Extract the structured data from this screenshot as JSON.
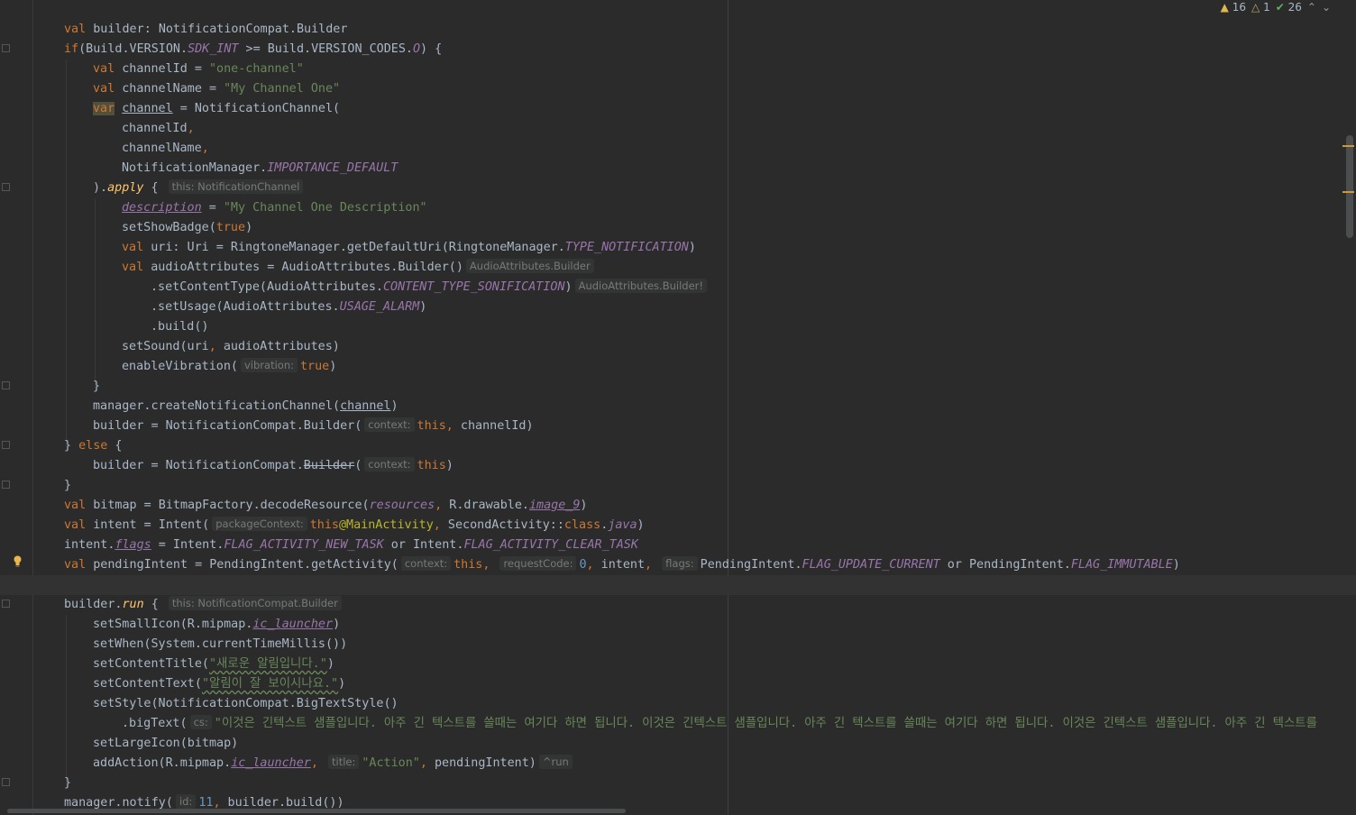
{
  "status": {
    "warnings": "16",
    "weak_warnings": "1",
    "typos": "26",
    "warning_icon": "warning-triangle-icon",
    "weak_warning_icon": "weak-warning-triangle-icon",
    "typo_icon": "typo-check-icon",
    "nav_up_icon": "chevron-up-icon",
    "nav_down_icon": "chevron-down-icon"
  },
  "hints": {
    "this_channel": "this: NotificationChannel",
    "audio_builder": "AudioAttributes.Builder",
    "audio_builder_bang": "AudioAttributes.Builder!",
    "vibration": "vibration:",
    "context": "context:",
    "package_context": "packageContext:",
    "request_code": "requestCode:",
    "flags": "flags:",
    "this_builder": "this: NotificationCompat.Builder",
    "cs": "cs:",
    "title": "title:",
    "run": "^run",
    "id": "id:"
  },
  "code": {
    "builder_decl_name": "builder",
    "builder_decl_type": "NotificationCompat.Builder",
    "sdk_int": "SDK_INT",
    "version_code": "O",
    "channel_id_value": "\"one-channel\"",
    "channel_name_value": "\"My Channel One\"",
    "importance": "IMPORTANCE_DEFAULT",
    "description_value": "\"My Channel One Description\"",
    "type_notification": "TYPE_NOTIFICATION",
    "content_type": "CONTENT_TYPE_SONIFICATION",
    "usage_alarm": "USAGE_ALARM",
    "image_res": "image_9",
    "main_activity": "@MainActivity",
    "flag_new_task": "FLAG_ACTIVITY_NEW_TASK",
    "flag_clear_task": "FLAG_ACTIVITY_CLEAR_TASK",
    "request_code_value": "0",
    "flag_update_current": "FLAG_UPDATE_CURRENT",
    "flag_immutable": "FLAG_IMMUTABLE",
    "ic_launcher": "ic_launcher",
    "content_title": "\"새로운 알림입니다.\"",
    "content_text": "\"알림이 잘 보이시나요.\"",
    "big_text": "\"이것은 긴텍스트 샘플입니다. 아주 긴 텍스트를 쓸때는 여기다 하면 됩니다. 이것은 긴텍스트 샘플입니다. 아주 긴 텍스트를 쓸때는 여기다 하면 됩니다. 이것은 긴텍스트 샘플입니다. 아주 긴 텍스트를",
    "action_title": "\"Action\"",
    "notify_id": "11"
  }
}
